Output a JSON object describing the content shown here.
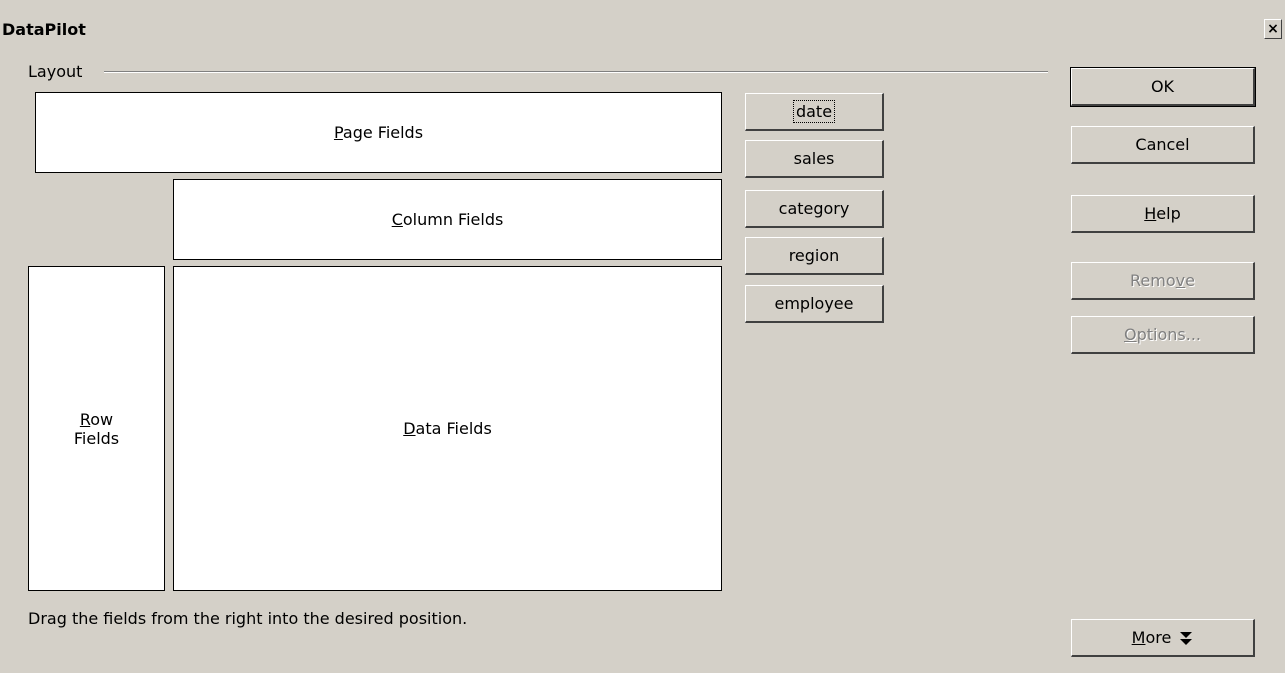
{
  "window": {
    "title": "DataPilot",
    "close_label": "×"
  },
  "layout": {
    "group_label": "Layout",
    "page_fields": {
      "accel": "P",
      "rest": "age Fields"
    },
    "column_fields": {
      "accel": "C",
      "rest": "olumn Fields"
    },
    "row_fields": {
      "accel": "R",
      "rest": "ow",
      "line2": "Fields"
    },
    "data_fields": {
      "accel": "D",
      "rest": "ata Fields"
    },
    "hint": "Drag the fields from the right into the desired position."
  },
  "fields": [
    {
      "label": "date",
      "focused": true
    },
    {
      "label": "sales"
    },
    {
      "label": "category"
    },
    {
      "label": "region"
    },
    {
      "label": "employee"
    }
  ],
  "buttons": {
    "ok": "OK",
    "cancel": "Cancel",
    "help": {
      "accel": "H",
      "rest": "elp"
    },
    "remove": {
      "pre": "Remo",
      "accel": "v",
      "rest": "e"
    },
    "options": {
      "accel": "O",
      "rest": "ptions..."
    },
    "more": {
      "accel": "M",
      "rest": "ore"
    }
  },
  "icons": {
    "close": "close-icon",
    "more": "double-chevron-down-icon"
  }
}
